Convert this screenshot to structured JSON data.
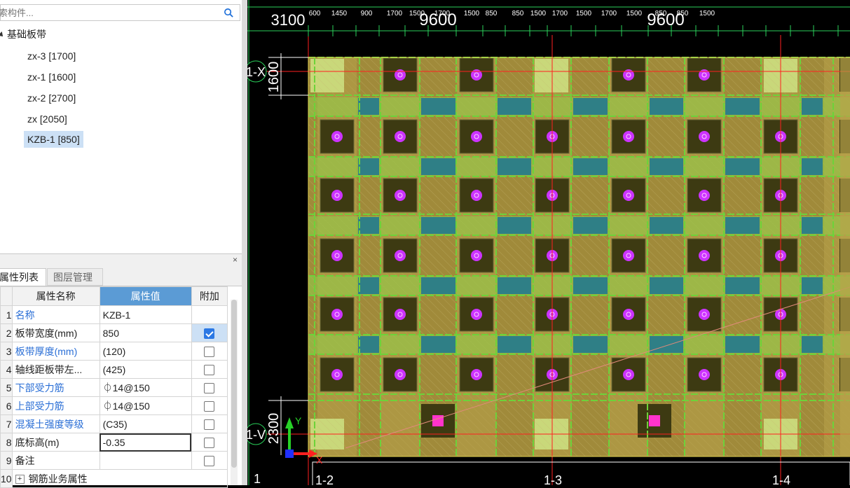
{
  "search": {
    "placeholder": "搜索构件..."
  },
  "tree": {
    "root": "基础板带",
    "items": [
      {
        "label": "zx-3 [1700]"
      },
      {
        "label": "zx-1 [1600]"
      },
      {
        "label": "zx-2 [2700]"
      },
      {
        "label": "zx [2050]"
      },
      {
        "label": "KZB-1 [850]",
        "selected": true
      }
    ]
  },
  "tabs": {
    "props": "属性列表",
    "layers": "图层管理"
  },
  "props": {
    "headers": {
      "name": "属性名称",
      "value": "属性值",
      "extra": "附加"
    },
    "rows": [
      {
        "num": "1",
        "name": "名称",
        "value": "KZB-1",
        "blue": true,
        "checkbox": "none"
      },
      {
        "num": "2",
        "name": "板带宽度(mm)",
        "value": "850",
        "blue": false,
        "checkbox": "on"
      },
      {
        "num": "3",
        "name": "板带厚度(mm)",
        "value": "(120)",
        "blue": true,
        "checkbox": "off"
      },
      {
        "num": "4",
        "name": "轴线距板带左...",
        "value": "(425)",
        "blue": false,
        "checkbox": "off"
      },
      {
        "num": "5",
        "name": "下部受力筋",
        "value": "⏀14@150",
        "blue": true,
        "checkbox": "off"
      },
      {
        "num": "6",
        "name": "上部受力筋",
        "value": "⏀14@150",
        "blue": true,
        "checkbox": "off"
      },
      {
        "num": "7",
        "name": "混凝土强度等级",
        "value": "(C35)",
        "blue": true,
        "checkbox": "off"
      },
      {
        "num": "8",
        "name": "底标高(m)",
        "value": "-0.35",
        "blue": false,
        "checkbox": "off",
        "editing": true
      },
      {
        "num": "9",
        "name": "备注",
        "value": "",
        "blue": false,
        "checkbox": "off"
      },
      {
        "num": "10",
        "name": "钢筋业务属性",
        "value": "",
        "blue": false,
        "checkbox": "none",
        "expander": true
      }
    ]
  },
  "cad": {
    "big_dims": [
      "3100",
      "9600",
      "9600"
    ],
    "small_dims": [
      "600",
      "1450",
      "900",
      "1700",
      "1500",
      "1700",
      "1500",
      "850",
      "850",
      "1500",
      "1700",
      "1500",
      "1700",
      "1500",
      "850",
      "850",
      "1500"
    ],
    "vert_dims": [
      "1600",
      "2300"
    ],
    "axis_labels": [
      "1-X",
      "1-V"
    ],
    "bottom_labels": [
      "1",
      "1-2",
      "1-3",
      "1-4"
    ],
    "ucs": {
      "y": "Y",
      "x": "X"
    },
    "colors": {
      "slab": "#a08a3a",
      "band": "#6dd23a",
      "cap": "#3d3a12",
      "pile": "#cc33ff",
      "teal": "#2f7f86",
      "grid": "#ff2020",
      "dim": "#2ad15a"
    }
  }
}
